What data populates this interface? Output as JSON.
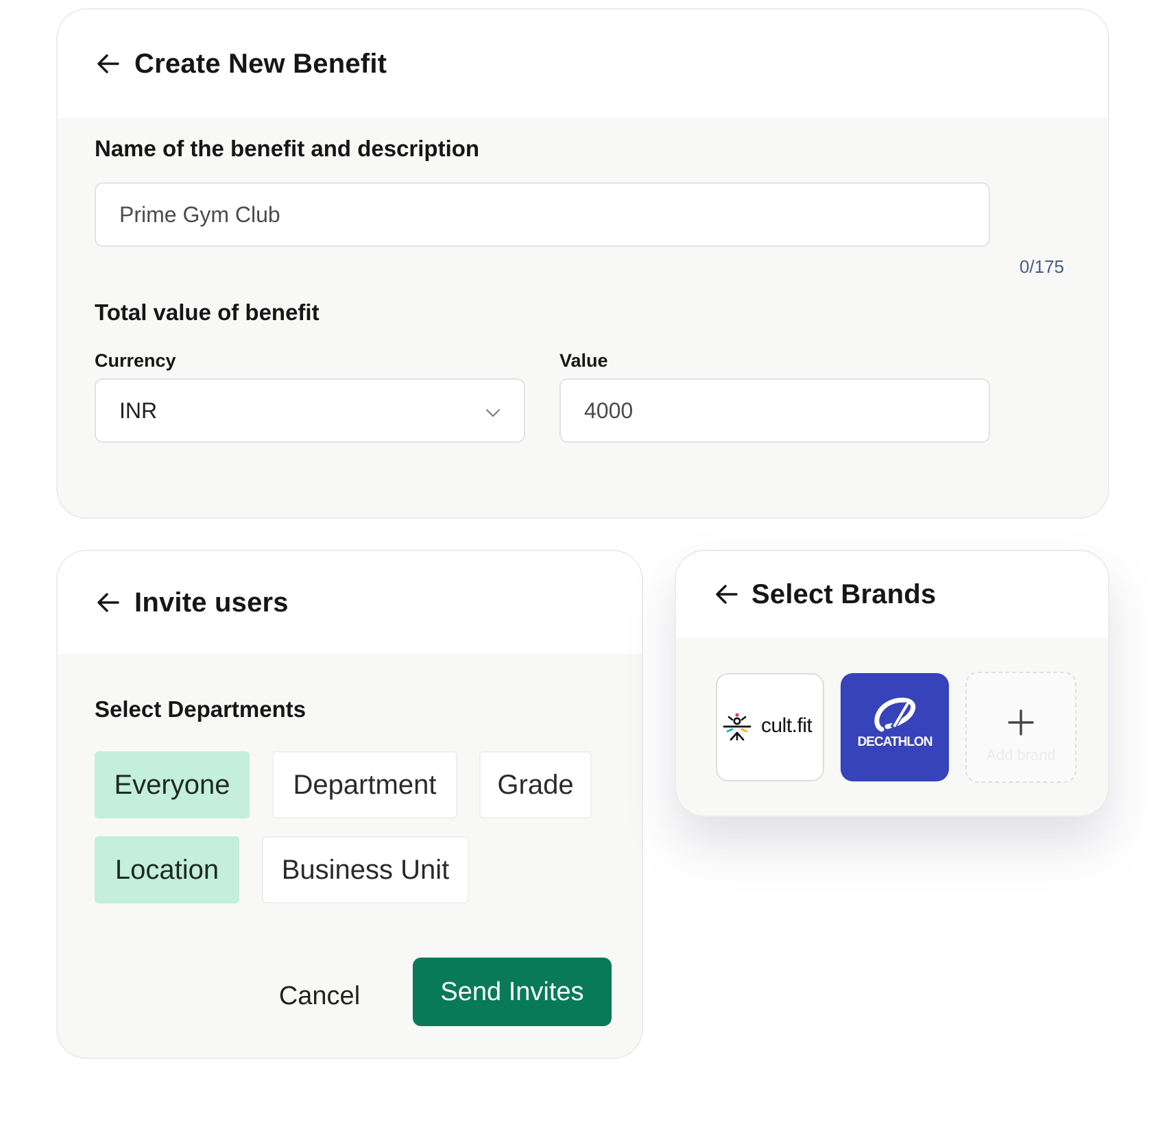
{
  "benefit": {
    "title": "Create New Benefit",
    "section_name_label": "Name of the benefit and description",
    "name_value": "Prime Gym Club",
    "char_counter": "0/175",
    "section_value_label": "Total value of benefit",
    "currency_label": "Currency",
    "currency_value": "INR",
    "value_label": "Value",
    "value_value": "4000"
  },
  "invite": {
    "title": "Invite users",
    "section_label": "Select Departments",
    "chips": [
      {
        "label": "Everyone",
        "selected": true
      },
      {
        "label": "Department",
        "selected": false
      },
      {
        "label": "Grade",
        "selected": false
      },
      {
        "label": "Location",
        "selected": true
      },
      {
        "label": "Business Unit",
        "selected": false
      }
    ],
    "cancel_label": "Cancel",
    "send_label": "Send Invites"
  },
  "brands": {
    "title": "Select Brands",
    "items": [
      {
        "name": "cult.fit"
      },
      {
        "name": "DECATHLON"
      }
    ],
    "add_label": "Add brand"
  },
  "colors": {
    "accent": "#087a57",
    "chip_selected": "#c4eedd",
    "decathlon_blue": "#3643ba"
  },
  "icons": {
    "back": "arrow-left-icon",
    "dropdown": "chevron-down-icon",
    "add": "plus-icon"
  }
}
